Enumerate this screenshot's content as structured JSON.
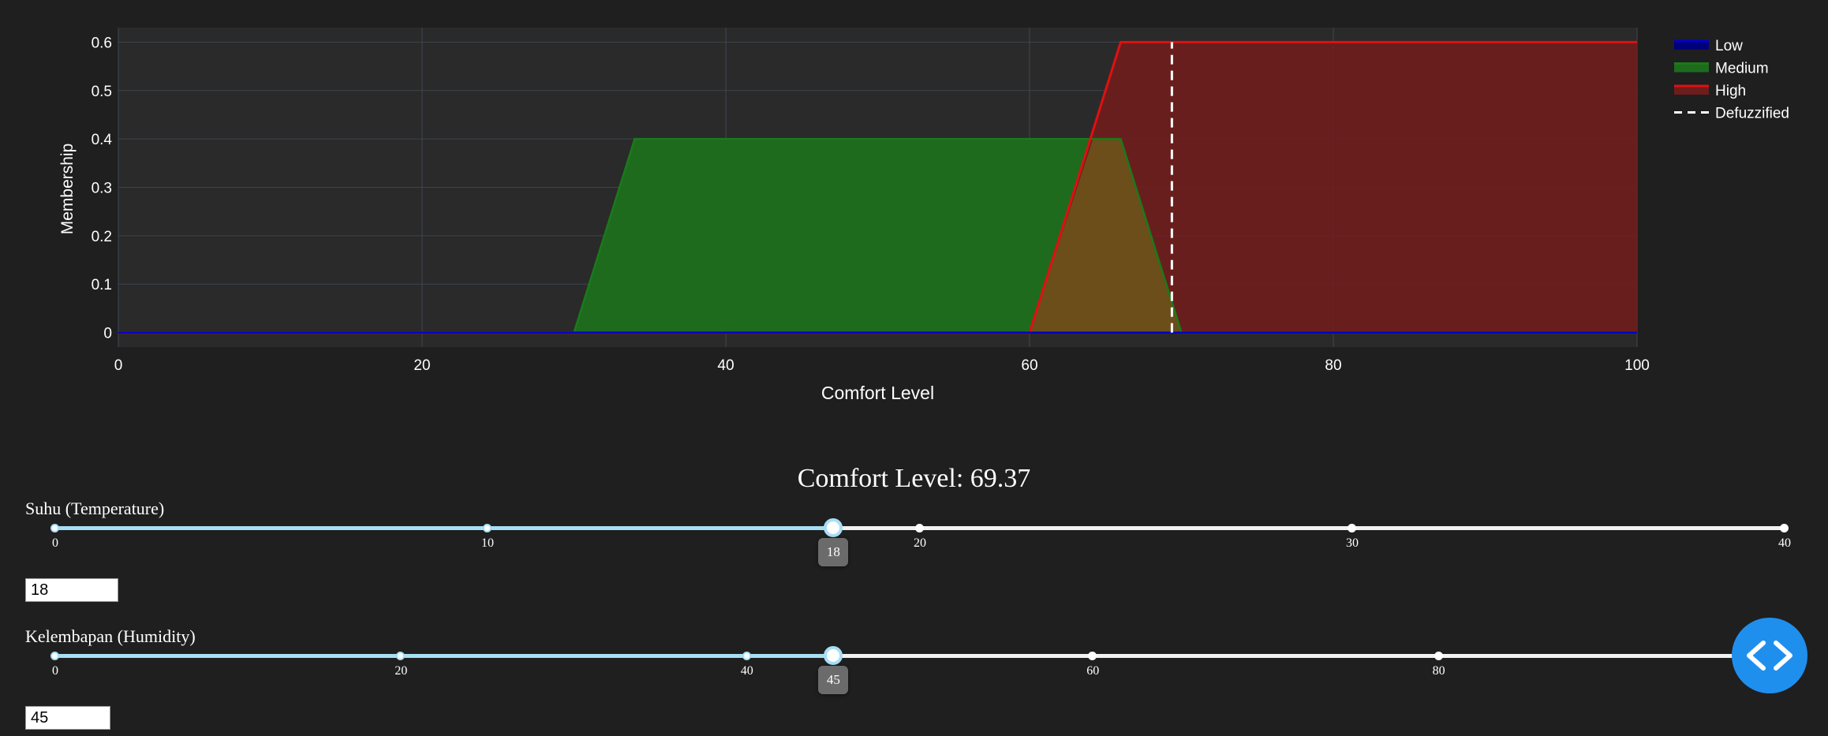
{
  "chart_data": {
    "type": "area",
    "xlabel": "Comfort Level",
    "ylabel": "Membership",
    "xlim": [
      0,
      100
    ],
    "ylim": [
      -0.03,
      0.63
    ],
    "xticks": [
      0,
      20,
      40,
      60,
      80,
      100
    ],
    "yticks": [
      0,
      0.1,
      0.2,
      0.3,
      0.4,
      0.5,
      0.6
    ],
    "grid": true,
    "legend": "top-right",
    "series": [
      {
        "name": "Low",
        "color": "#0000cc",
        "fill": "#00007a",
        "x": [
          0,
          60,
          70,
          100
        ],
        "y": [
          0,
          0,
          0,
          0
        ]
      },
      {
        "name": "Medium",
        "color": "#1a7a1a",
        "fill": "#1e6b1e",
        "x": [
          0,
          30,
          34,
          66,
          70,
          100
        ],
        "y": [
          0,
          0,
          0.4,
          0.4,
          0,
          0
        ]
      },
      {
        "name": "High",
        "color": "#e01010",
        "fill": "#6e1d1d",
        "x": [
          0,
          60,
          66,
          100
        ],
        "y": [
          0,
          0,
          0.6,
          0.6
        ]
      }
    ],
    "overlap_fill": "#6b4e1a",
    "defuzzified": {
      "name": "Defuzzified",
      "x": 69.37,
      "y": [
        0,
        0.6
      ],
      "color": "#ffffff"
    }
  },
  "result": {
    "title": "Comfort Level: 69.37"
  },
  "sliders": [
    {
      "id": "temp",
      "label": "Suhu (Temperature)",
      "min": 0,
      "max": 40,
      "value": 18,
      "marks": [
        0,
        10,
        20,
        30,
        40
      ],
      "input_value": "18"
    },
    {
      "id": "hum",
      "label": "Kelembapan (Humidity)",
      "min": 0,
      "max": 100,
      "value": 45,
      "marks": [
        0,
        20,
        40,
        60,
        80
      ],
      "input_value": "45"
    }
  ],
  "colors": {
    "background": "#1f1f1f",
    "plot_bg": "#2a2a2a",
    "slider_track": "#a6dff5",
    "fab": "#1f8fee"
  },
  "fab": {
    "icon": "code-icon"
  }
}
